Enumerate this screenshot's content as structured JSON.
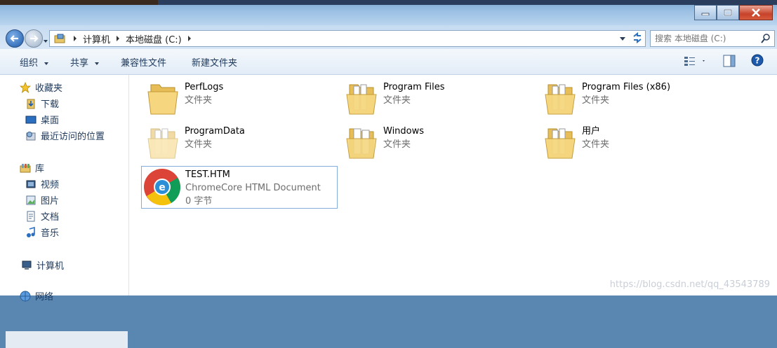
{
  "address": {
    "crumbs": [
      "计算机",
      "本地磁盘 (C:)"
    ]
  },
  "search": {
    "placeholder": "搜索 本地磁盘 (C:)"
  },
  "toolbar": {
    "organize": "组织",
    "share": "共享",
    "compat": "兼容性文件",
    "new_folder": "新建文件夹"
  },
  "sidebar": {
    "favorites": "收藏夹",
    "downloads": "下载",
    "desktop": "桌面",
    "recent": "最近访问的位置",
    "libraries": "库",
    "videos": "视频",
    "pictures": "图片",
    "documents": "文档",
    "music": "音乐",
    "computer": "计算机",
    "network": "网络"
  },
  "items": [
    {
      "name": "PerfLogs",
      "type": "文件夹"
    },
    {
      "name": "Program Files",
      "type": "文件夹"
    },
    {
      "name": "Program Files (x86)",
      "type": "文件夹"
    },
    {
      "name": "ProgramData",
      "type": "文件夹"
    },
    {
      "name": "Windows",
      "type": "文件夹"
    },
    {
      "name": "用户",
      "type": "文件夹"
    },
    {
      "name": "TEST.HTM",
      "type": "ChromeCore HTML Document",
      "size": "0 字节"
    }
  ],
  "watermark": "https://blog.csdn.net/qq_43543789",
  "colors": {
    "accent": "#1d5aab",
    "folder": "#f2c94c",
    "selection": "#84acdd"
  }
}
